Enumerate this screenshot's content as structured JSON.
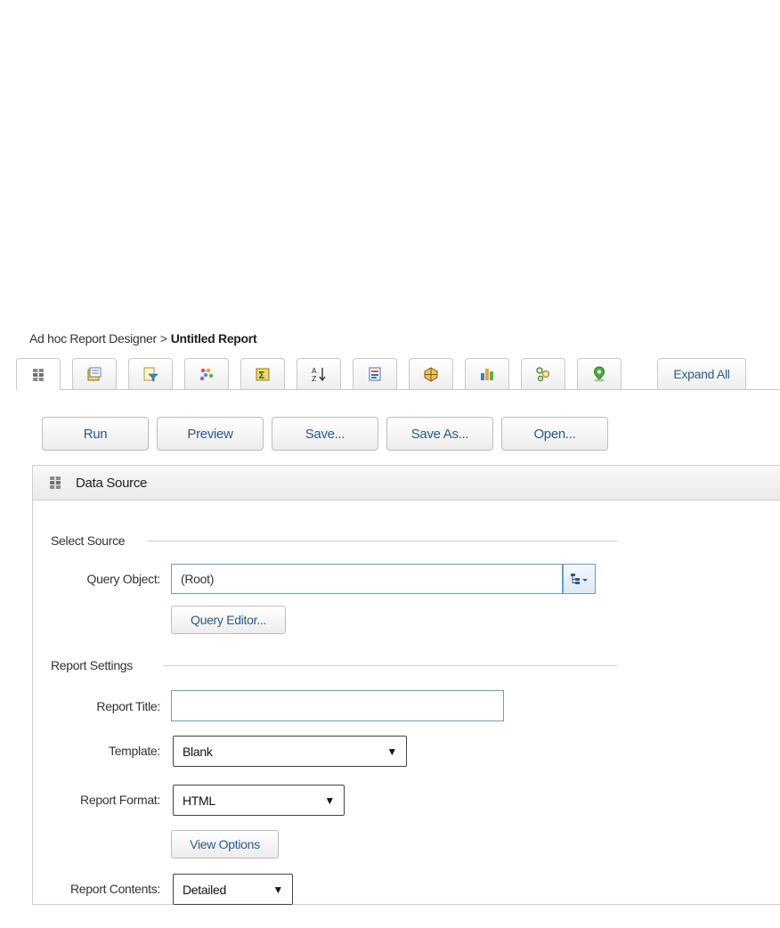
{
  "breadcrumb": {
    "root": "Ad hoc Report Designer",
    "separator": ">",
    "current": "Untitled Report"
  },
  "tabs": [
    {
      "name": "data-source-icon"
    },
    {
      "name": "report-settings-icon"
    },
    {
      "name": "filters-icon"
    },
    {
      "name": "grouping-icon"
    },
    {
      "name": "summary-icon"
    },
    {
      "name": "sort-icon"
    },
    {
      "name": "text-formatting-icon"
    },
    {
      "name": "pivot-icon"
    },
    {
      "name": "chart-icon"
    },
    {
      "name": "diagram-icon"
    },
    {
      "name": "map-icon"
    }
  ],
  "expand_all": "Expand All",
  "actions": {
    "run": "Run",
    "preview": "Preview",
    "save": "Save...",
    "save_as": "Save As...",
    "open": "Open..."
  },
  "panel": {
    "title": "Data Source",
    "select_source": {
      "heading": "Select Source",
      "query_object_label": "Query Object:",
      "query_object_value": "(Root)",
      "query_editor_button": "Query Editor..."
    },
    "report_settings": {
      "heading": "Report Settings",
      "report_title_label": "Report Title:",
      "report_title_value": "",
      "template_label": "Template:",
      "template_value": "Blank",
      "report_format_label": "Report Format:",
      "report_format_value": "HTML",
      "view_options_button": "View Options",
      "report_contents_label": "Report Contents:",
      "report_contents_value": "Detailed"
    }
  },
  "colors": {
    "link_blue": "#2b5b8a",
    "input_border": "#6a9ad0"
  }
}
